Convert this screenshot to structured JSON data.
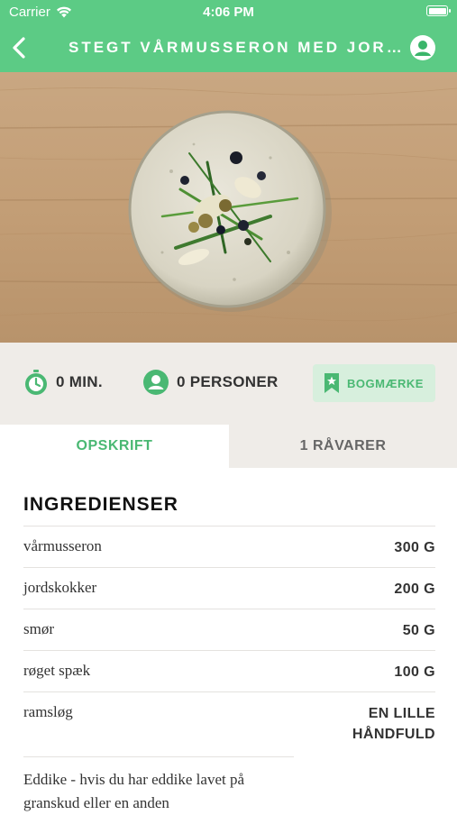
{
  "status_bar": {
    "carrier": "Carrier",
    "time": "4:06 PM"
  },
  "nav": {
    "title": "STEGT VÅRMUSSERON MED JORDS…"
  },
  "meta": {
    "time_label": "0 MIN.",
    "persons_label": "0 PERSONER",
    "bookmark_label": "BOGMÆRKE"
  },
  "tabs": [
    {
      "label": "OPSKRIFT",
      "active": true
    },
    {
      "label": "1 RÅVARER",
      "active": false
    }
  ],
  "ingredients": {
    "heading": "INGREDIENSER",
    "items": [
      {
        "name": "vårmusseron",
        "amount": "300 G"
      },
      {
        "name": "jordskokker",
        "amount": "200 G"
      },
      {
        "name": "smør",
        "amount": "50 G"
      },
      {
        "name": "røget spæk",
        "amount": "100 G"
      },
      {
        "name": "ramsløg",
        "amount_line1": "EN LILLE",
        "amount_line2": "HÅNDFULD"
      }
    ],
    "note": "Eddike - hvis du har eddike lavet på granskud eller en anden"
  },
  "colors": {
    "brand_green": "#5ccb85",
    "accent_green": "#4ab873",
    "meta_bg": "#efece8"
  }
}
